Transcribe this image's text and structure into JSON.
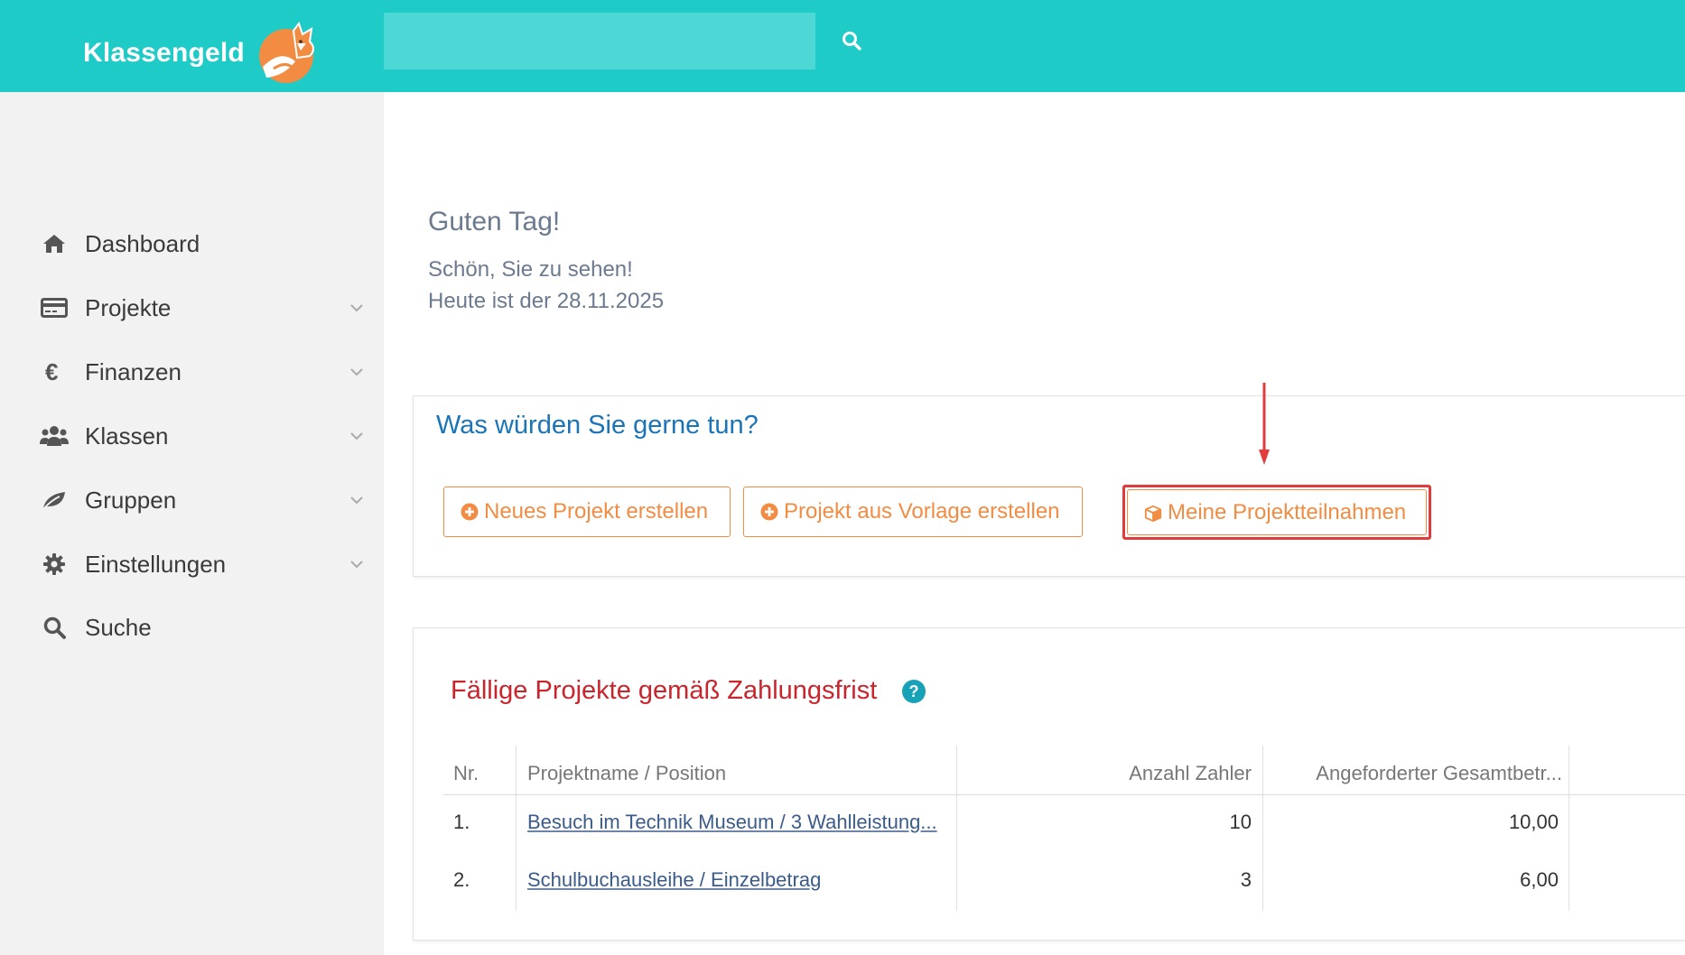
{
  "app": {
    "brand": "Klassengeld",
    "brand_color": "#1ecbc7",
    "accent_color": "#f28c43"
  },
  "search": {
    "placeholder": "",
    "value": "",
    "icon": "search-icon"
  },
  "sidebar": {
    "items": [
      {
        "label": "Dashboard",
        "icon": "home-icon",
        "expandable": false
      },
      {
        "label": "Projekte",
        "icon": "credit-card-icon",
        "expandable": true
      },
      {
        "label": "Finanzen",
        "icon": "euro-icon",
        "expandable": true
      },
      {
        "label": "Klassen",
        "icon": "users-icon",
        "expandable": true
      },
      {
        "label": "Gruppen",
        "icon": "leaf-icon",
        "expandable": true
      },
      {
        "label": "Einstellungen",
        "icon": "gear-icon",
        "expandable": true
      },
      {
        "label": "Suche",
        "icon": "search-icon",
        "expandable": false
      }
    ]
  },
  "greeting": {
    "title": "Guten Tag!",
    "line1": "Schön, Sie zu sehen!",
    "line2": "Heute ist der 28.11.2025"
  },
  "actions": {
    "title": "Was würden Sie gerne tun?",
    "buttons": [
      {
        "label": "Neues Projekt erstellen",
        "icon": "plus-circle-icon"
      },
      {
        "label": "Projekt aus Vorlage erstellen",
        "icon": "plus-circle-icon"
      },
      {
        "label": "Meine Projektteilnahmen",
        "icon": "cube-icon"
      }
    ]
  },
  "due_projects": {
    "title": "Fällige Projekte gemäß Zahlungsfrist",
    "help_label": "?",
    "columns": [
      "Nr.",
      "Projektname / Position",
      "Anzahl Zahler",
      "Angeforderter Gesamtbetr..."
    ],
    "rows": [
      {
        "nr": "1.",
        "name": "Besuch im Technik Museum / 3 Wahlleistung...",
        "payers": "10",
        "amount": "10,00"
      },
      {
        "nr": "2.",
        "name": "Schulbuchausleihe / Einzelbetrag",
        "payers": "3",
        "amount": "6,00"
      }
    ]
  }
}
